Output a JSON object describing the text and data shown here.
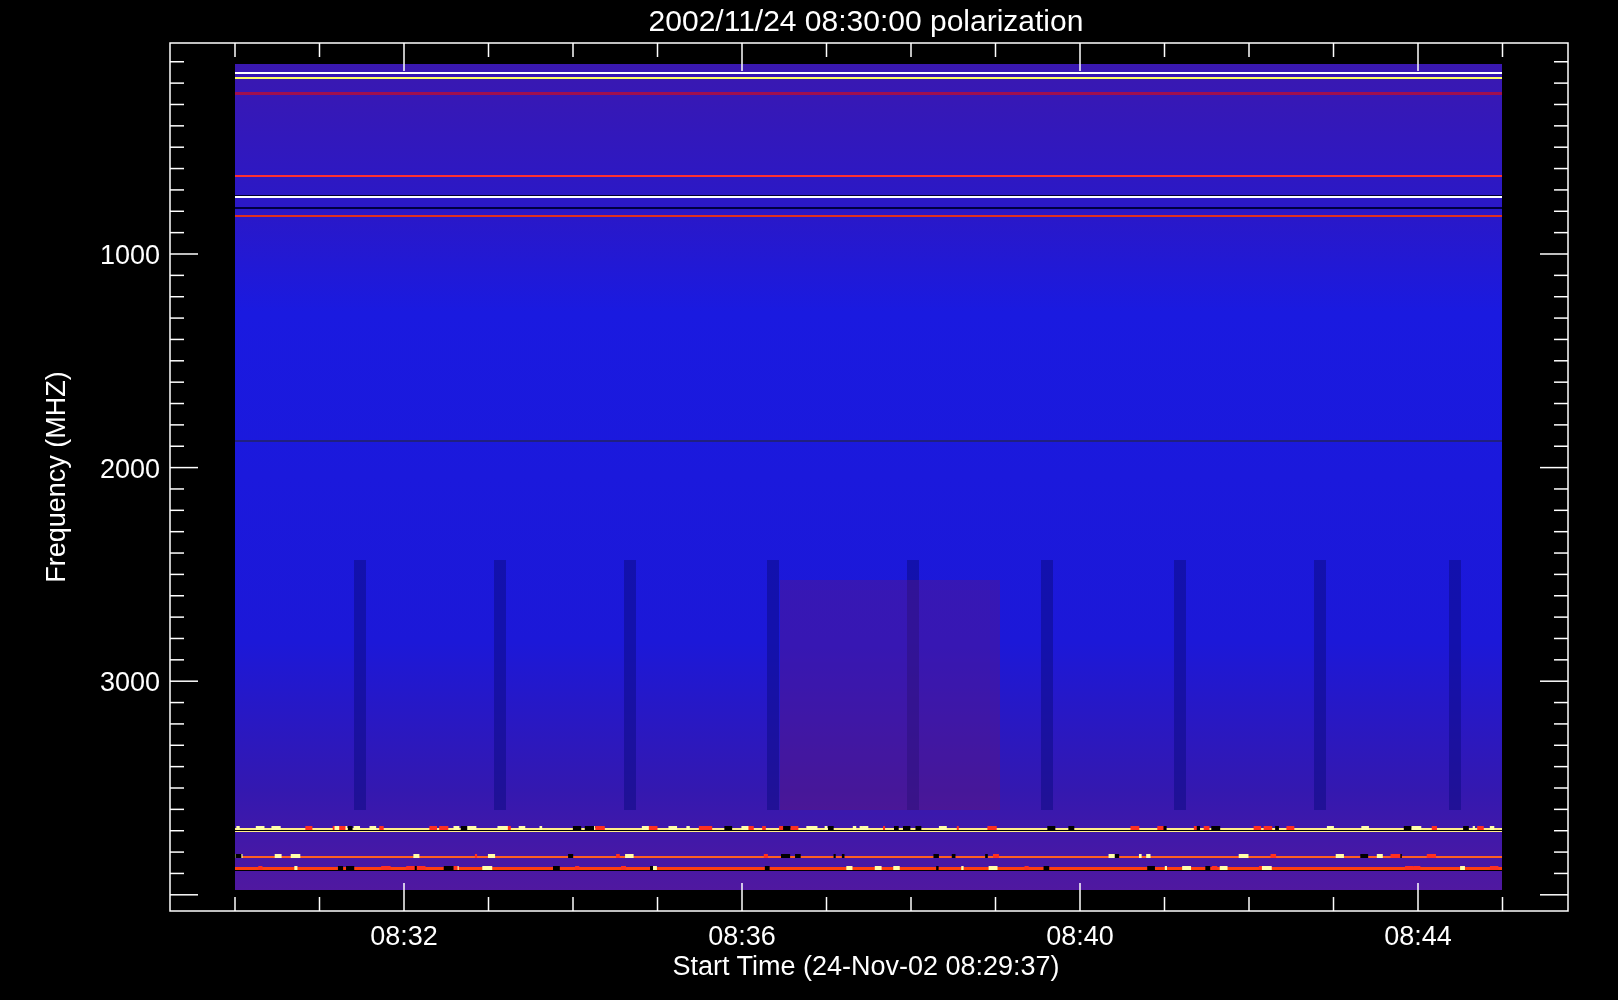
{
  "title": "2002/11/24 08:30:00 polarization",
  "y_axis": {
    "label": "Frequency (MHZ)",
    "ticks": [
      "1000",
      "2000",
      "3000"
    ]
  },
  "x_axis": {
    "label": "Start Time (24-Nov-02 08:29:37)",
    "ticks": [
      "08:32",
      "08:36",
      "08:40",
      "08:44"
    ]
  }
}
